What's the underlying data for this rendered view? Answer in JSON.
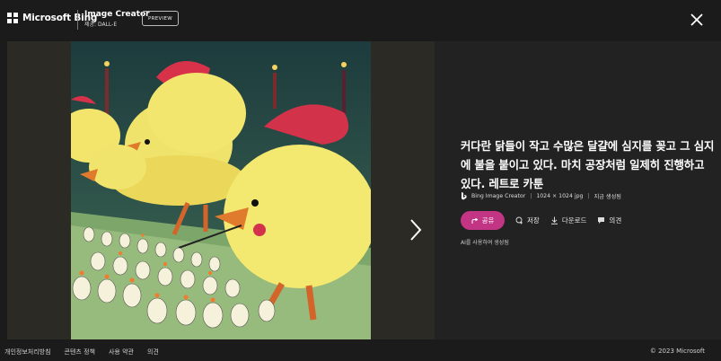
{
  "header": {
    "brand": "Microsoft Bing",
    "product_title": "Image Creator",
    "product_sub": "제공: DALL-E",
    "badge": "PREVIEW"
  },
  "image": {
    "caption": "",
    "style": "retro cartoon"
  },
  "info": {
    "title": "커다란 닭들이 작고 수많은 달걀에 심지를 꽂고 그 심지에 불을 붙이고 있다. 마치 공장처럼 일제히 진행하고 있다. 레트로 카툰",
    "source": "Bing Image Creator",
    "file_info": "1024 × 1024 jpg",
    "status": "지금 생성됨",
    "ai_note": "AI를 사용하여 생성됨"
  },
  "actions": {
    "share": "공유",
    "save": "저장",
    "download": "다운로드",
    "feedback": "의견"
  },
  "footer": {
    "links": [
      "개인정보처리방침",
      "콘텐츠 정책",
      "사용 약관",
      "의견"
    ],
    "copyright": "© 2023 Microsoft"
  },
  "colors": {
    "accent": "#c13584",
    "background": "#1b1b1b",
    "panel": "#222222"
  }
}
